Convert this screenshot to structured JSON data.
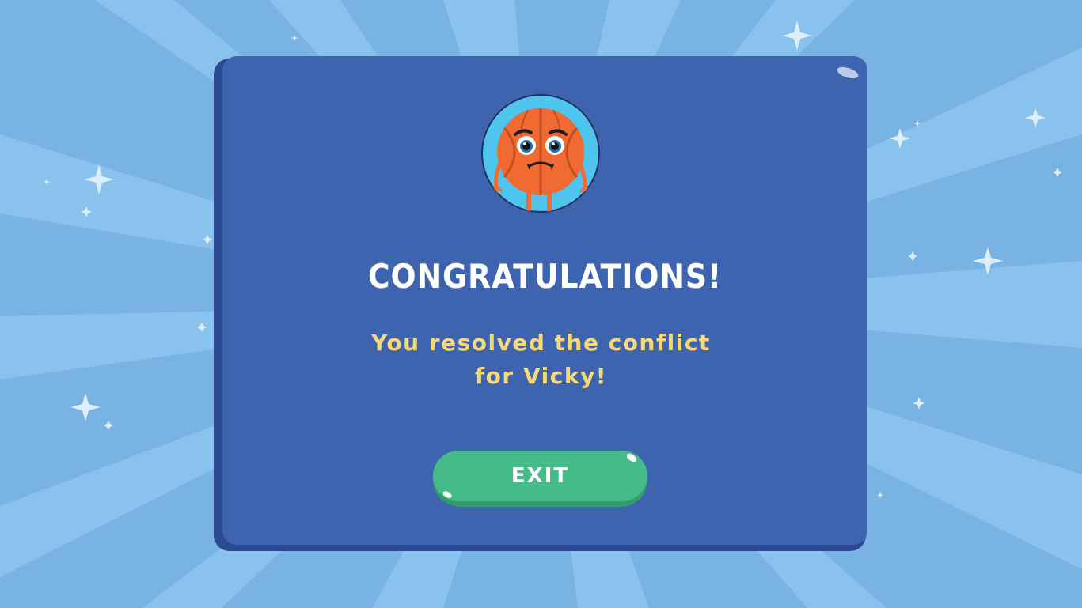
{
  "dialog": {
    "title": "CONGRATULATIONS!",
    "message_line1": "You resolved the conflict",
    "message_line2": "for Vicky!",
    "exit_label": "EXIT"
  },
  "character": {
    "name": "Vicky",
    "icon": "basketball-character-icon",
    "expression": "worried"
  },
  "colors": {
    "background": "#7db7e6",
    "background_rays": "#8ec5ee",
    "panel": "#3e64b0",
    "panel_shadow": "#2c4a93",
    "title_text": "#ffffff",
    "message_text": "#f5d978",
    "exit_button": "#45bb87",
    "exit_button_shadow": "#2f9c6a",
    "avatar_circle": "#4ec5ef",
    "ball_orange": "#f06a31"
  }
}
